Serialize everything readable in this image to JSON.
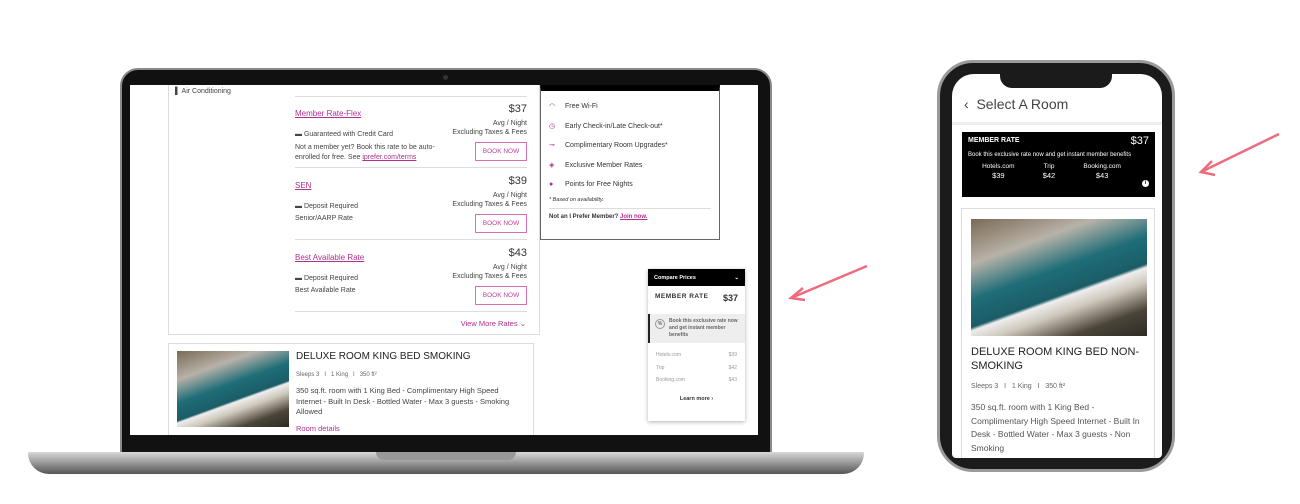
{
  "laptop": {
    "amenity": "Air Conditioning",
    "rates": [
      {
        "name": "Member Rate-Flex",
        "policy": "Guaranteed with Credit Card",
        "desc": "Not a member yet? Book this rate to be auto-enrolled for free. See ",
        "desc_link": "iprefer.com/terms",
        "price": "$37",
        "unit": "Avg / Night",
        "note": "Excluding Taxes & Fees",
        "button": "BOOK NOW"
      },
      {
        "name": "SEN",
        "policy": "Deposit Required",
        "desc": "Senior/AARP Rate",
        "price": "$39",
        "unit": "Avg / Night",
        "note": "Excluding Taxes & Fees",
        "button": "BOOK NOW"
      },
      {
        "name": "Best Available Rate",
        "policy": "Deposit Required",
        "desc": "Best Available Rate",
        "price": "$43",
        "unit": "Avg / Night",
        "note": "Excluding Taxes & Fees",
        "button": "BOOK NOW"
      }
    ],
    "view_more": "View More Rates",
    "benefits": {
      "items": [
        "Free Wi-Fi",
        "Early Check-in/Late Check-out*",
        "Complimentary Room Upgrades*",
        "Exclusive Member Rates",
        "Points for Free Nights"
      ],
      "footnote": "* Based on availability.",
      "cta_prefix": "Not an I Prefer Member? ",
      "cta_link": "Join now."
    },
    "room": {
      "title": "DELUXE ROOM KING BED SMOKING",
      "meta": "Sleeps 3   I   1 King   I   350 ft²",
      "desc": "350 sq.ft. room with 1 King Bed - Complimentary High Speed Internet - Built In Desk - Bottled Water - Max 3 guests - Smoking Allowed",
      "details": "Room details"
    },
    "compare": {
      "header": "Compare Prices",
      "label": "MEMBER RATE",
      "price": "$37",
      "message": "Book this exclusive rate now and get instant member benefits",
      "sites": [
        {
          "name": "Hotels.com",
          "price": "$39"
        },
        {
          "name": "Trip",
          "price": "$42"
        },
        {
          "name": "Booking.com",
          "price": "$43"
        }
      ],
      "learn_more": "Learn more"
    }
  },
  "phone": {
    "title": "Select A Room",
    "banner": {
      "label": "MEMBER RATE",
      "price": "$37",
      "message": "Book this exclusive rate now and get instant member benefits",
      "sites": [
        {
          "name": "Hotels.com",
          "price": "$39"
        },
        {
          "name": "Trip",
          "price": "$42"
        },
        {
          "name": "Booking.com",
          "price": "$43"
        }
      ]
    },
    "room": {
      "title": "DELUXE ROOM KING BED NON-SMOKING",
      "meta": "Sleeps 3   I   1 King   I   350 ft²",
      "desc": "350 sq.ft. room with 1 King Bed - Complimentary High Speed Internet - Built In Desk - Bottled Water - Max 3 guests - Non Smoking"
    }
  },
  "colors": {
    "accent": "#b0308f",
    "arrow": "#ee6b7e"
  }
}
